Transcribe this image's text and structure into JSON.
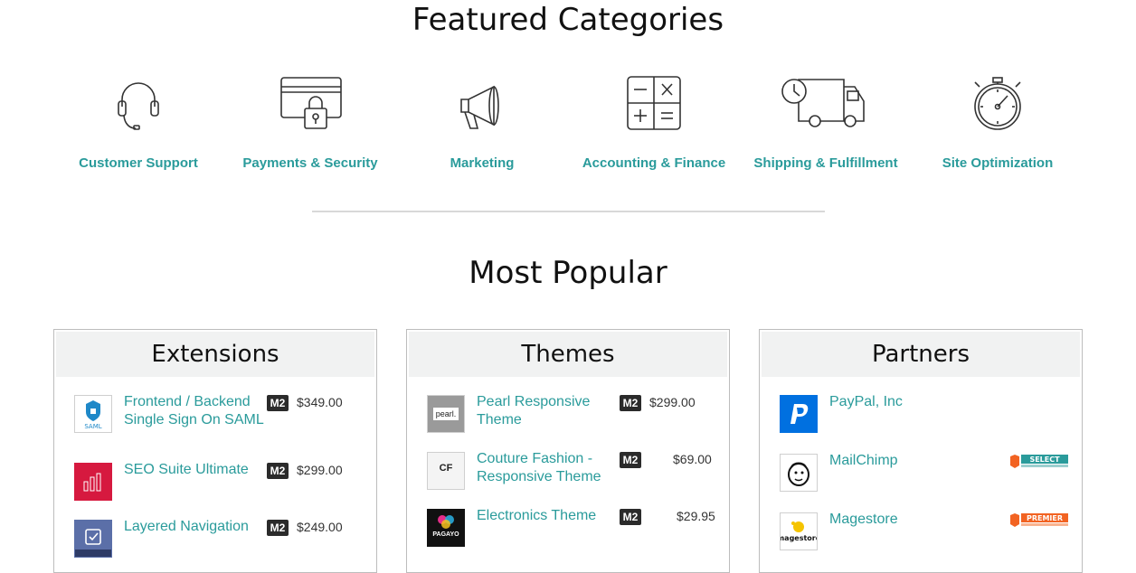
{
  "featured": {
    "title": "Featured Categories",
    "categories": [
      {
        "label": "Customer Support",
        "icon": "headset-icon"
      },
      {
        "label": "Payments & Security",
        "icon": "card-lock-icon"
      },
      {
        "label": "Marketing",
        "icon": "megaphone-icon"
      },
      {
        "label": "Accounting & Finance",
        "icon": "calculator-icon"
      },
      {
        "label": "Shipping & Fulfillment",
        "icon": "delivery-truck-icon"
      },
      {
        "label": "Site Optimization",
        "icon": "stopwatch-icon"
      }
    ]
  },
  "popular": {
    "title": "Most Popular",
    "extensions": {
      "heading": "Extensions",
      "items": [
        {
          "name": "Frontend / Backend Single Sign On SAML",
          "badge": "M2",
          "price": "$349.00"
        },
        {
          "name": "SEO Suite Ultimate",
          "badge": "M2",
          "price": "$299.00"
        },
        {
          "name": "Layered Navigation",
          "badge": "M2",
          "price": "$249.00"
        }
      ]
    },
    "themes": {
      "heading": "Themes",
      "items": [
        {
          "name": "Pearl Responsive Theme",
          "badge": "M2",
          "price": "$299.00",
          "thumb_text": "pearl."
        },
        {
          "name": "Couture Fashion - Responsive Theme",
          "badge": "M2",
          "price": "$69.00",
          "thumb_text": "CF"
        },
        {
          "name": "Electronics Theme",
          "badge": "M2",
          "price": "$29.95",
          "thumb_text": "PAGAYO"
        }
      ]
    },
    "partners": {
      "heading": "Partners",
      "items": [
        {
          "name": "PayPal, Inc",
          "level": ""
        },
        {
          "name": "MailChimp",
          "level": "SELECT"
        },
        {
          "name": "Magestore",
          "level": "PREMIER"
        }
      ]
    }
  },
  "colors": {
    "accent": "#2a9b9b",
    "badge": "#2b2b2b",
    "partner_level": "#f26322"
  }
}
